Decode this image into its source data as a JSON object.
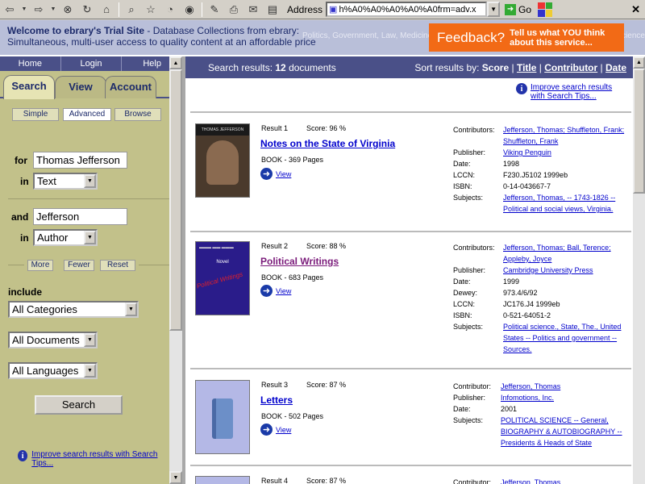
{
  "browser": {
    "address_label": "Address",
    "address_value": "h%A0%A0%A0%A0%A0frm=adv.x",
    "go_label": "Go"
  },
  "banner": {
    "welcome_bold": "Welcome to ebrary's Trial Site",
    "welcome_rest": " - Database Collections from ebrary:",
    "tagline": "Simultaneous, multi-user access to quality content at an affordable price",
    "background_text": "Politics, Government, Law, Medicine, Archives, Dissertations, Working Papers, Culinary Science",
    "feedback_title": "Feedback?",
    "feedback_sub": "Tell us what YOU think about this service...",
    "feedback_color": "#f26a16"
  },
  "sidebar": {
    "topnav": [
      "Home",
      "Login",
      "Help"
    ],
    "tabs": [
      "Search",
      "View",
      "Account"
    ],
    "subtabs": [
      "Simple",
      "Advanced",
      "Browse"
    ],
    "for_label": "for",
    "in_label": "in",
    "and_label": "and",
    "query1": "Thomas Jefferson",
    "field1": "Text",
    "query2": "Jefferson",
    "field2": "Author",
    "more": "More",
    "fewer": "Fewer",
    "reset": "Reset",
    "include_label": "include",
    "categories": "All Categories",
    "documents": "All Documents",
    "languages": "All Languages",
    "search_button": "Search",
    "tip": "Improve search results with Search Tips..."
  },
  "results": {
    "prefix": "Search results: ",
    "count": "12",
    "suffix": " documents",
    "sort_label": "Sort results by: ",
    "sort_score": "Score",
    "sort_title": "Title",
    "sort_contributor": "Contributor",
    "sort_date": "Date",
    "tip": "Improve search results with Search Tips...",
    "view_label": "View",
    "items": [
      {
        "no": "Result 1",
        "score": "Score: 96 %",
        "title": "Notes on the State of Virginia",
        "type": "BOOK - 369 Pages",
        "meta": [
          {
            "k": "Contributors:",
            "v": "Jefferson, Thomas; Shuffleton, Frank; Shuffleton, Frank",
            "link": true
          },
          {
            "k": "Publisher:",
            "v": "Viking Penguin",
            "link": true
          },
          {
            "k": "Date:",
            "v": "1998"
          },
          {
            "k": "LCCN:",
            "v": "F230.J5102 1999eb"
          },
          {
            "k": "ISBN:",
            "v": "0-14-043667-7"
          },
          {
            "k": "Subjects:",
            "v": "Jefferson, Thomas, -- 1743-1826 -- Political and social views, Virginia.",
            "link": true
          }
        ]
      },
      {
        "no": "Result 2",
        "score": "Score: 88 %",
        "title": "Political Writings",
        "type": "BOOK - 683 Pages",
        "meta": [
          {
            "k": "Contributors:",
            "v": "Jefferson, Thomas; Ball, Terence; Appleby, Joyce",
            "link": true
          },
          {
            "k": "Publisher:",
            "v": "Cambridge University Press",
            "link": true
          },
          {
            "k": "Date:",
            "v": "1999"
          },
          {
            "k": "Dewey:",
            "v": "973.4/6/92"
          },
          {
            "k": "LCCN:",
            "v": "JC176.J4 1999eb"
          },
          {
            "k": "ISBN:",
            "v": "0-521-64051-2"
          },
          {
            "k": "Subjects:",
            "v": "Political science., State, The., United States -- Politics and government -- Sources.",
            "link": true
          }
        ]
      },
      {
        "no": "Result 3",
        "score": "Score: 87 %",
        "title": "Letters",
        "type": "BOOK - 502 Pages",
        "meta": [
          {
            "k": "Contributor:",
            "v": "Jefferson, Thomas",
            "link": true
          },
          {
            "k": "Publisher:",
            "v": "Infomotions, Inc.",
            "link": true
          },
          {
            "k": "Date:",
            "v": "2001"
          },
          {
            "k": "Subjects:",
            "v": "POLITICAL SCIENCE -- General, BIOGRAPHY & AUTOBIOGRAPHY -- Presidents & Heads of State",
            "link": true
          }
        ]
      },
      {
        "no": "Result 4",
        "score": "Score: 87 %",
        "meta": [
          {
            "k": "Contributor:",
            "v": "Jefferson, Thomas",
            "link": true
          }
        ]
      }
    ]
  },
  "cover_texts": {
    "cover1_top": "THOMAS JEFFERSON",
    "cover2_word": "Novel",
    "cover2_red": "Political Writings"
  }
}
